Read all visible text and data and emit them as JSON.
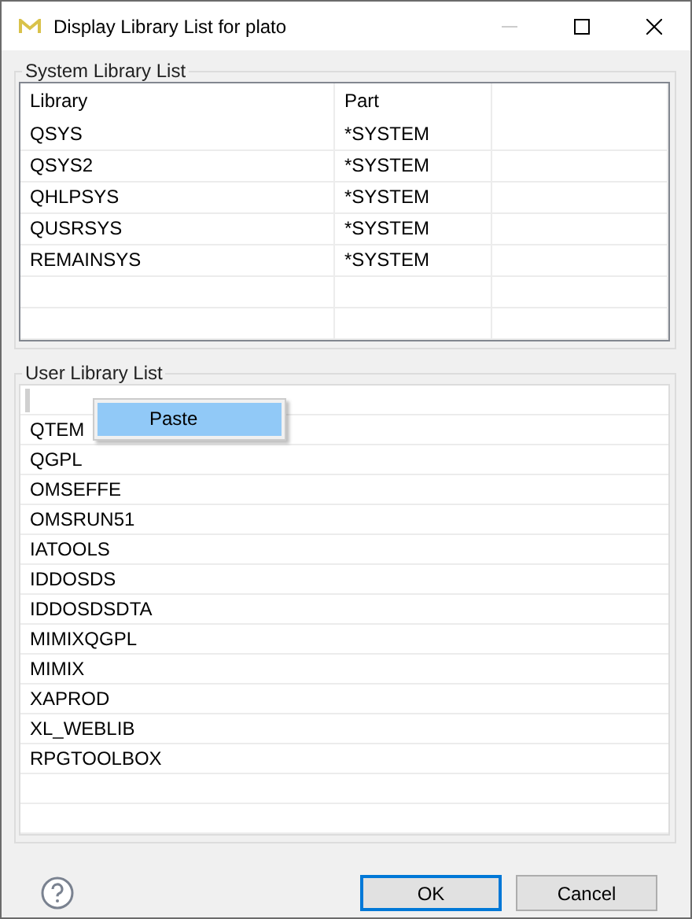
{
  "window": {
    "title": "Display Library List for plato"
  },
  "system_library_list": {
    "title": "System Library List",
    "columns": [
      "Library",
      "Part"
    ],
    "rows": [
      [
        "QSYS",
        "*SYSTEM"
      ],
      [
        "QSYS2",
        "*SYSTEM"
      ],
      [
        "QHLPSYS",
        "*SYSTEM"
      ],
      [
        "QUSRSYS",
        "*SYSTEM"
      ],
      [
        "REMAINSYS",
        "*SYSTEM"
      ]
    ]
  },
  "user_library_list": {
    "title": "User Library List",
    "rows": [
      "QTEM",
      "QGPL",
      "OMSEFFE",
      "OMSRUN51",
      "IATOOLS",
      "IDDOSDS",
      "IDDOSDSDTA",
      "MIMIXQGPL",
      "MIMIX",
      "XAPROD",
      "XL_WEBLIB",
      "RPGTOOLBOX"
    ]
  },
  "context_menu": {
    "items": [
      {
        "label": "Paste",
        "selected": true
      }
    ]
  },
  "buttons": [
    {
      "label": "OK",
      "default": true
    },
    {
      "label": "Cancel",
      "default": false
    }
  ]
}
